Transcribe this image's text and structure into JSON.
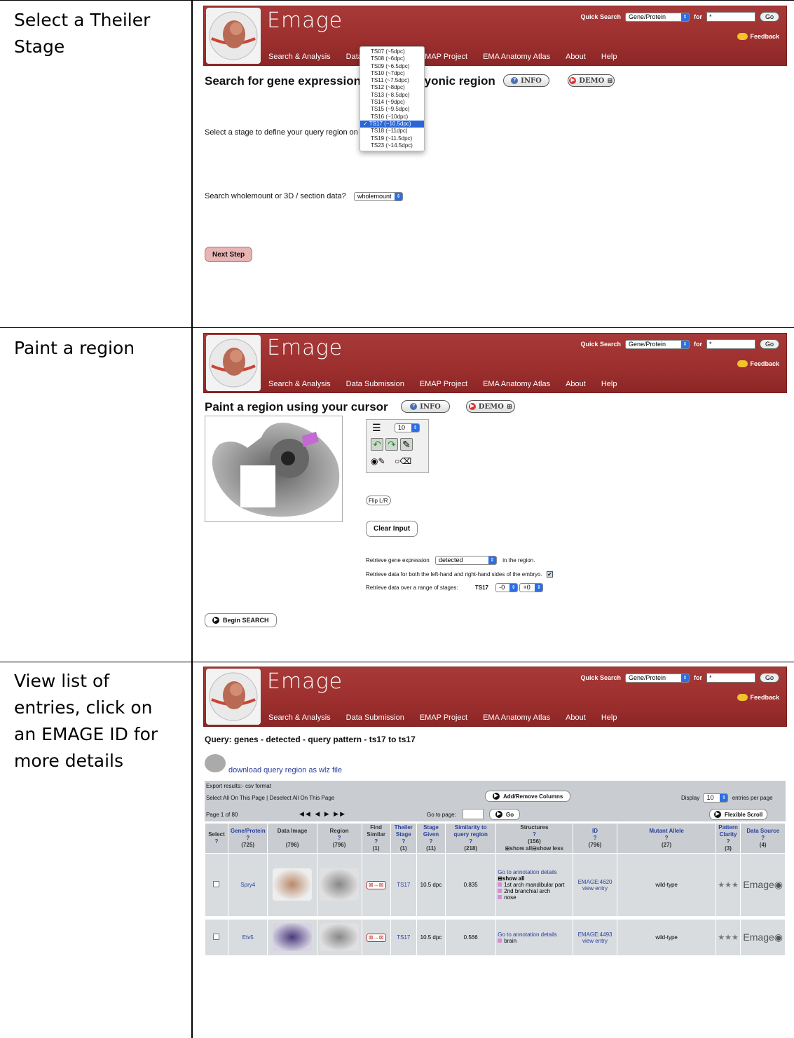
{
  "rows": [
    {
      "label": "Select a Theiler Stage"
    },
    {
      "label": "Paint a region"
    },
    {
      "label": "View list of entries, click on an EMAGE ID for more details"
    }
  ],
  "header": {
    "brand": "Emage",
    "quick_search_label": "Quick Search",
    "quick_search_select": "Gene/Protein",
    "for_label": "for",
    "search_value": "*",
    "go_label": "Go",
    "feedback_label": "Feedback",
    "nav": [
      "Search & Analysis",
      "Data Submission",
      "EMAP Project",
      "EMA Anatomy Atlas",
      "About",
      "Help"
    ]
  },
  "panel1": {
    "title": "Search for gene expression in an embryonic region",
    "info_label": "INFO",
    "demo_label": "DEMO",
    "stage_prompt": "Select a stage to define your query region on",
    "stage_options": [
      "TS07 (~5dpc)",
      "TS08 (~6dpc)",
      "TS09 (~6.5dpc)",
      "TS10 (~7dpc)",
      "TS11 (~7.5dpc)",
      "TS12 (~8dpc)",
      "TS13 (~8.5dpc)",
      "TS14 (~9dpc)",
      "TS15 (~9.5dpc)",
      "TS16 (~10dpc)",
      "TS17 (~10.5dpc)",
      "TS18 (~11dpc)",
      "TS19 (~11.5dpc)",
      "TS23 (~14.5dpc)"
    ],
    "selected_stage": "TS17 (~10.5dpc)",
    "data_prompt": "Search wholemount or 3D / section data?",
    "data_select": "wholemount",
    "next_label": "Next Step"
  },
  "panel2": {
    "title": "Paint a region using your cursor",
    "info_label": "INFO",
    "demo_label": "DEMO",
    "brush_size": "10",
    "flip_label": "Flip L/R",
    "clear_label": "Clear Input",
    "retrieve_expr_prefix": "Retrieve gene expression",
    "expr_select": "detected",
    "retrieve_expr_suffix": "in the region.",
    "both_sides_label": "Retrieve data for both the left-hand and right-hand sides of the embryo.",
    "stage_range_label": "Retrieve data over a range of stages:",
    "stage_value": "TS17",
    "minus_select": "-0",
    "plus_select": "+0",
    "search_label": "Begin SEARCH"
  },
  "panel3": {
    "query_title": "Query: genes - detected - query pattern - ts17 to ts17",
    "download_label": "download query region as wlz file",
    "export_label": "Export results:- csv format",
    "select_all": "Select All On This Page",
    "deselect_all": "Deselect All On This Page",
    "add_remove_label": "Add/Remove Columns",
    "display_label": "Display",
    "display_value": "10",
    "per_page_label": "entries per page",
    "page_label": "Page 1 of 80",
    "pager_glyphs": "◀◀ ◀ ▶ ▶▶",
    "goto_label": "Go to page:",
    "go_label": "Go",
    "flex_label": "Flexible Scroll",
    "columns": [
      {
        "name": "Select",
        "count": ""
      },
      {
        "name": "Gene/Protein",
        "count": "(725)"
      },
      {
        "name": "Data Image",
        "count": "(796)"
      },
      {
        "name": "Region",
        "count": "(796)"
      },
      {
        "name": "Find Similar",
        "count": "(1)"
      },
      {
        "name": "Theiler Stage",
        "count": "(1)"
      },
      {
        "name": "Stage Given",
        "count": "(11)"
      },
      {
        "name": "Similarity to query region",
        "count": "(218)"
      },
      {
        "name": "Structures",
        "count": "(156)"
      },
      {
        "name": "ID",
        "count": "(796)"
      },
      {
        "name": "Mutant Allele",
        "count": "(27)"
      },
      {
        "name": "Pattern Clarity",
        "count": "(3)"
      },
      {
        "name": "Data Source",
        "count": "(4)"
      }
    ],
    "show_all_less": "⊞show all⊟show less",
    "entries": [
      {
        "gene": "Spry4",
        "stage": "TS17",
        "given": "10.5 dpc",
        "similarity": "0.835",
        "annot": "Go to annotation details",
        "show_all": "⊞show all",
        "structures": [
          "1st arch mandibular part",
          "2nd branchial arch",
          "nose"
        ],
        "id": "EMAGE:4620",
        "view": "view entry",
        "allele": "wild-type",
        "clarity": "★★★",
        "source": "Emage"
      },
      {
        "gene": "Etv5",
        "stage": "TS17",
        "given": "10.5 dpc",
        "similarity": "0.566",
        "annot": "Go to annotation details",
        "show_all": "",
        "structures": [
          "brain"
        ],
        "id": "EMAGE:4493",
        "view": "view entry",
        "allele": "wild-type",
        "clarity": "★★★",
        "source": "Emage"
      }
    ]
  },
  "colors": {
    "header_red": "#9c2f2e",
    "link_blue": "#2a3f9c",
    "selected_blue": "#2a66d6"
  }
}
